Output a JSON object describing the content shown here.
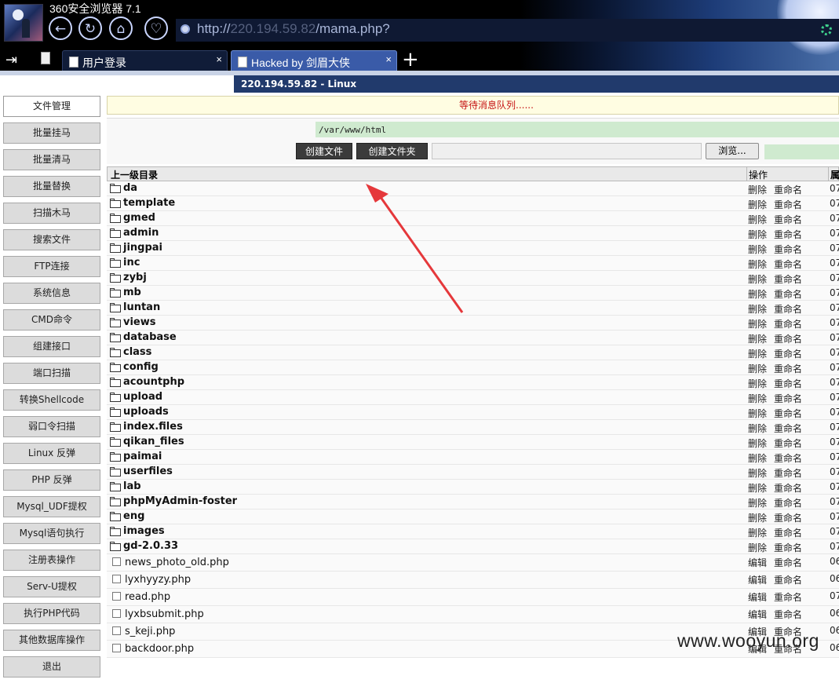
{
  "browser": {
    "app_title": "360安全浏览器 7.1",
    "nav": {
      "back_icon": "arrow-left-icon",
      "refresh_icon": "refresh-icon",
      "home_icon": "home-icon",
      "favorites_icon": "heart-icon"
    },
    "address": {
      "scheme": "http://",
      "host": "220.194.59.82",
      "path": "/mama.php?"
    },
    "tabs": [
      {
        "label": "用户登录",
        "close": "×"
      },
      {
        "label": "Hacked by 剑眉大侠",
        "close": "×"
      }
    ],
    "new_tab": "+",
    "sidebar_toggle": "⇥"
  },
  "page": {
    "host_banner": "220.194.59.82 - Linux",
    "menu": [
      "文件管理",
      "批量挂马",
      "批量清马",
      "批量替换",
      "扫描木马",
      "搜索文件",
      "FTP连接",
      "系统信息",
      "CMD命令",
      "组建接口",
      "端口扫描",
      "转换Shellcode",
      "弱口令扫描",
      "Linux 反弹",
      "PHP 反弹",
      "Mysql_UDF提权",
      "Mysql语句执行",
      "注册表操作",
      "Serv-U提权",
      "执行PHP代码",
      "其他数据库操作",
      "退出"
    ],
    "message": "等待消息队列......",
    "path_value": "/var/www/html",
    "buttons": {
      "new_file": "创建文件",
      "new_folder": "创建文件夹",
      "browse": "浏览..."
    },
    "table": {
      "col_name": "上一级目录",
      "col_ops": "操作",
      "col_date": "属"
    },
    "dirs": [
      "da",
      "template",
      "gmed",
      "admin",
      "jingpai",
      "inc",
      "zybj",
      "mb",
      "luntan",
      "views",
      "database",
      "class",
      "config",
      "acountphp",
      "upload",
      "uploads",
      "index.files",
      "qikan_files",
      "paimai",
      "userfiles",
      "lab",
      "phpMyAdmin-foster",
      "eng",
      "images",
      "gd-2.0.33"
    ],
    "dir_ops": {
      "delete": "删除",
      "rename": "重命名",
      "date": "07"
    },
    "files": [
      {
        "name": "news_photo_old.php",
        "date": "06"
      },
      {
        "name": "lyxhyyzy.php",
        "date": "06"
      },
      {
        "name": "read.php",
        "date": "07"
      },
      {
        "name": "lyxbsubmit.php",
        "date": "06"
      },
      {
        "name": "s_keji.php",
        "date": "06"
      },
      {
        "name": "backdoor.php",
        "date": "06"
      }
    ],
    "file_ops": {
      "edit": "编辑",
      "rename": "重命名"
    }
  },
  "watermark": "www.wooyun.org",
  "colors": {
    "host_banner": "#213a6c",
    "message_text": "#c61515",
    "annotation_arrow": "#e5383b"
  }
}
